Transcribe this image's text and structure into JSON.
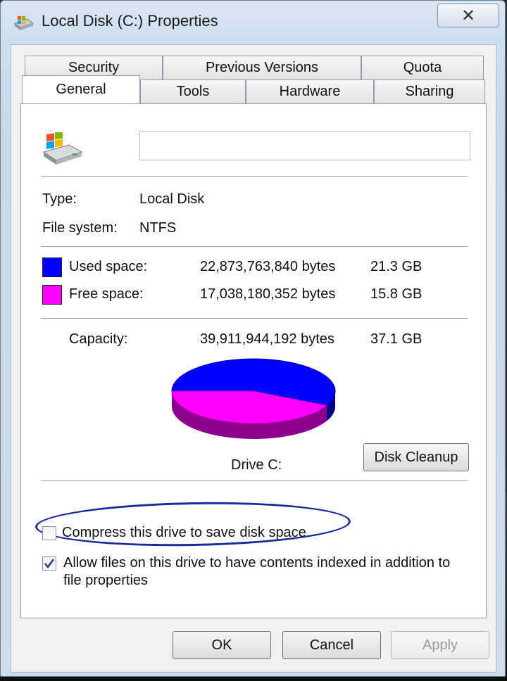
{
  "window": {
    "title": "Local Disk (C:) Properties",
    "close_label": "✕"
  },
  "tabs": {
    "row_back": [
      "Security",
      "Previous Versions",
      "Quota"
    ],
    "row_front": [
      "General",
      "Tools",
      "Hardware",
      "Sharing"
    ],
    "active": "General"
  },
  "general": {
    "volume_label_value": "",
    "type_label": "Type:",
    "type_value": "Local Disk",
    "fs_label": "File system:",
    "fs_value": "NTFS",
    "used": {
      "label": "Used space:",
      "bytes": "22,873,763,840 bytes",
      "size": "21.3 GB",
      "color": "#0000ff"
    },
    "free": {
      "label": "Free space:",
      "bytes": "17,038,180,352 bytes",
      "size": "15.8 GB",
      "color": "#ff00ff"
    },
    "capacity": {
      "label": "Capacity:",
      "bytes": "39,911,944,192 bytes",
      "size": "37.1 GB"
    },
    "drive_caption": "Drive C:",
    "cleanup_label": "Disk Cleanup",
    "compress_label": "Compress this drive to save disk space",
    "compress_checked": false,
    "index_label_line1": "Allow files on this drive to have contents indexed in addition to",
    "index_label_line2": "file properties",
    "index_checked": true
  },
  "chart_data": {
    "type": "pie",
    "title": "",
    "categories": [
      "Used space",
      "Free space"
    ],
    "values": [
      22873763840,
      17038180352
    ],
    "colors": [
      "#0000ff",
      "#ff00ff"
    ]
  },
  "footer": {
    "ok_label": "OK",
    "cancel_label": "Cancel",
    "apply_label": "Apply",
    "apply_enabled": false
  }
}
